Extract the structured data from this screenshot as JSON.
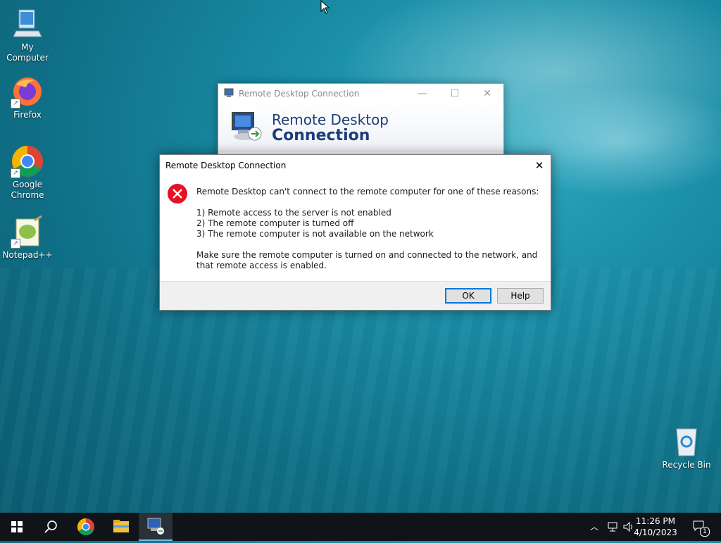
{
  "desktop": {
    "icons": [
      {
        "label": "My Computer",
        "icon": "computer-icon"
      },
      {
        "label": "Firefox",
        "icon": "firefox-icon"
      },
      {
        "label": "Google Chrome",
        "icon": "chrome-icon"
      },
      {
        "label": "Notepad++",
        "icon": "notepadpp-icon"
      },
      {
        "label": "Recycle Bin",
        "icon": "recycle-bin-icon"
      }
    ]
  },
  "rdc_window": {
    "title": "Remote Desktop Connection",
    "banner_line1": "Remote Desktop",
    "banner_line2": "Connection"
  },
  "error_dialog": {
    "title": "Remote Desktop Connection",
    "icon": "error-icon",
    "intro": "Remote Desktop can't connect to the remote computer for one of these reasons:",
    "reasons": [
      "1) Remote access to the server is not enabled",
      "2) The remote computer is turned off",
      "3) The remote computer is not available on the network"
    ],
    "advice": "Make sure the remote computer is turned on and connected to the network, and that remote access is enabled.",
    "ok_label": "OK",
    "help_label": "Help"
  },
  "taskbar": {
    "items": [
      "start-icon",
      "search-icon",
      "chrome-icon",
      "file-explorer-icon",
      "remote-desktop-icon"
    ],
    "time": "11:26 PM",
    "date": "4/10/2023",
    "notification_count": "1"
  },
  "colors": {
    "accent": "#0078d7",
    "error_red": "#e81123",
    "taskbar_bg": "#101418",
    "banner_text": "#1c3f7a"
  }
}
